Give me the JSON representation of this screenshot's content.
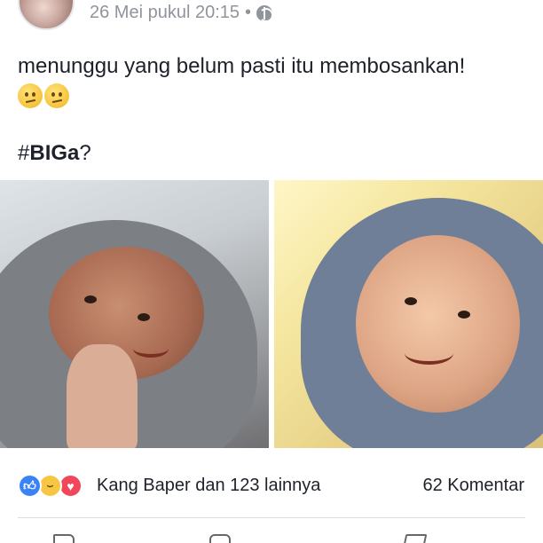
{
  "post": {
    "timestamp": "26 Mei pukul 20:15",
    "separator": "•",
    "privacy_icon": "globe-icon",
    "text": "menunggu yang belum pasti itu membosankan!",
    "emojis": [
      "confused-face",
      "confused-face"
    ],
    "hashtag_prefix": "#",
    "hashtag_bold": "BIGa",
    "hashtag_suffix": "?"
  },
  "reactions": {
    "icons": [
      "like",
      "haha",
      "love"
    ],
    "summary": "Kang Baper dan 123 lainnya",
    "comments": "62 Komentar"
  },
  "colors": {
    "like": "#3b82f6",
    "haha": "#f7c744",
    "love": "#f0475a",
    "meta": "#90949c"
  }
}
